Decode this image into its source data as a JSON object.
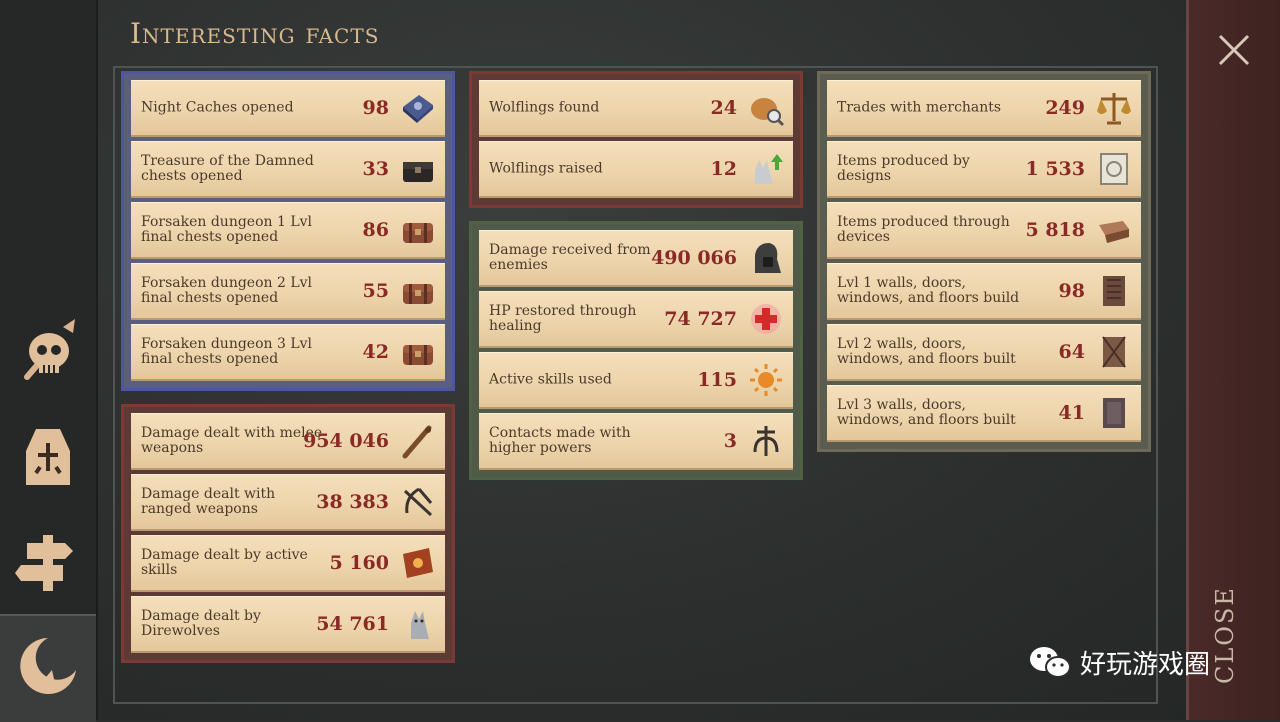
{
  "title": "Interesting facts",
  "close_label": "CLOSE",
  "watermark_text": "好玩游戏圈",
  "sidebar": [
    {
      "name": "skull-icon"
    },
    {
      "name": "character-icon"
    },
    {
      "name": "signpost-icon"
    },
    {
      "name": "crescent-icon"
    }
  ],
  "groups": {
    "blue": [
      {
        "label": "Night Caches opened",
        "value": "98",
        "icon": "night-cache-icon"
      },
      {
        "label": "Treasure of the Damned chests opened",
        "value": "33",
        "icon": "dark-chest-icon"
      },
      {
        "label": "Forsaken dungeon 1 Lvl final chests opened",
        "value": "86",
        "icon": "chest-icon"
      },
      {
        "label": "Forsaken dungeon 2 Lvl final chests opened",
        "value": "55",
        "icon": "chest-icon"
      },
      {
        "label": "Forsaken dungeon 3 Lvl final chests opened",
        "value": "42",
        "icon": "chest-icon"
      }
    ],
    "red_top": [
      {
        "label": "Wolflings found",
        "value": "24",
        "icon": "bag-search-icon"
      },
      {
        "label": "Wolflings raised",
        "value": "12",
        "icon": "wolf-up-icon"
      }
    ],
    "red_bottom": [
      {
        "label": "Damage dealt with melee weapons",
        "value": "954 046",
        "icon": "club-icon"
      },
      {
        "label": "Damage dealt with ranged weapons",
        "value": "38 383",
        "icon": "crossbow-icon"
      },
      {
        "label": "Damage dealt by active skills",
        "value": "5 160",
        "icon": "spellbook-icon"
      },
      {
        "label": "Damage dealt by Direwolves",
        "value": "54 761",
        "icon": "wolf-icon"
      }
    ],
    "green": [
      {
        "label": "Damage received from enemies",
        "value": "490 066",
        "icon": "hood-icon"
      },
      {
        "label": "HP restored through healing",
        "value": "74 727",
        "icon": "red-cross-icon"
      },
      {
        "label": "Active skills used",
        "value": "115",
        "icon": "sun-icon"
      },
      {
        "label": "Contacts made with higher powers",
        "value": "3",
        "icon": "rune-icon"
      }
    ],
    "tan": [
      {
        "label": "Trades with merchants",
        "value": "249",
        "icon": "scales-icon"
      },
      {
        "label": "Items produced by designs",
        "value": "1 533",
        "icon": "blueprint-icon"
      },
      {
        "label": "Items produced through devices",
        "value": "5 818",
        "icon": "anvil-icon"
      },
      {
        "label": "Lvl 1 walls, doors, windows, and floors build",
        "value": "98",
        "icon": "wooden-door-icon"
      },
      {
        "label": "Lvl 2 walls, doors, windows, and floors built",
        "value": "64",
        "icon": "reinforced-door-icon"
      },
      {
        "label": "Lvl 3 walls, doors, windows, and floors built",
        "value": "41",
        "icon": "iron-door-icon"
      }
    ]
  },
  "colors": {
    "value": "#8a2a26",
    "label": "#4b3a2a",
    "title": "#d9b98d"
  }
}
